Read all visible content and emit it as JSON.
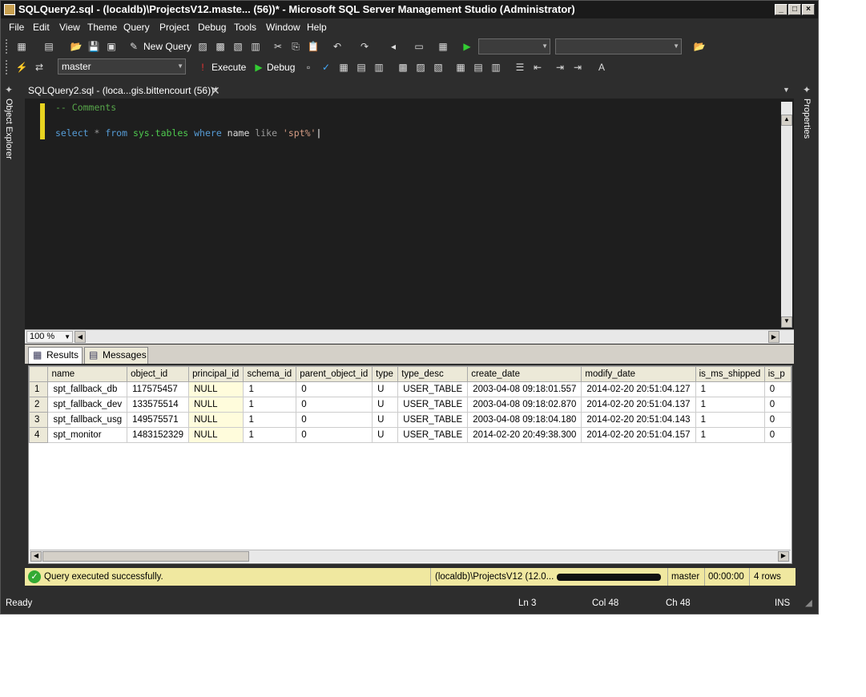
{
  "title": "SQLQuery2.sql - (localdb)\\ProjectsV12.maste... (56))* - Microsoft SQL Server Management Studio (Administrator)",
  "menu": [
    "File",
    "Edit",
    "View",
    "Theme",
    "Query",
    "Project",
    "Debug",
    "Tools",
    "Window",
    "Help"
  ],
  "toolbar": {
    "new_query_label": "New Query"
  },
  "toolbar2": {
    "database": "master",
    "execute_label": "Execute",
    "debug_label": "Debug"
  },
  "left_rail": {
    "label": "Object Explorer"
  },
  "right_rail": {
    "label": "Properties"
  },
  "doc_tab": {
    "label": "SQLQuery2.sql - (loca...gis.bittencourt (56))*"
  },
  "editor": {
    "comment": "-- Comments",
    "kw_select": "select",
    "star": " * ",
    "kw_from": "from",
    "obj": " sys.tables ",
    "kw_where": "where",
    "col": " name ",
    "kw_like": "like",
    "str": " 'spt%'"
  },
  "zoom": {
    "level": "100 %"
  },
  "results_tabs": {
    "results": "Results",
    "messages": "Messages"
  },
  "grid": {
    "columns": [
      "name",
      "object_id",
      "principal_id",
      "schema_id",
      "parent_object_id",
      "type",
      "type_desc",
      "create_date",
      "modify_date",
      "is_ms_shipped",
      "is_p"
    ],
    "rows": [
      [
        "1",
        "spt_fallback_db",
        "117575457",
        "NULL",
        "1",
        "0",
        "U",
        "USER_TABLE",
        "2003-04-08 09:18:01.557",
        "2014-02-20 20:51:04.127",
        "1",
        "0"
      ],
      [
        "2",
        "spt_fallback_dev",
        "133575514",
        "NULL",
        "1",
        "0",
        "U",
        "USER_TABLE",
        "2003-04-08 09:18:02.870",
        "2014-02-20 20:51:04.137",
        "1",
        "0"
      ],
      [
        "3",
        "spt_fallback_usg",
        "149575571",
        "NULL",
        "1",
        "0",
        "U",
        "USER_TABLE",
        "2003-04-08 09:18:04.180",
        "2014-02-20 20:51:04.143",
        "1",
        "0"
      ],
      [
        "4",
        "spt_monitor",
        "1483152329",
        "NULL",
        "1",
        "0",
        "U",
        "USER_TABLE",
        "2014-02-20 20:49:38.300",
        "2014-02-20 20:51:04.157",
        "1",
        "0"
      ]
    ]
  },
  "query_status": {
    "message": "Query executed successfully.",
    "server": "(localdb)\\ProjectsV12 (12.0...",
    "database": "master",
    "elapsed": "00:00:00",
    "rows": "4 rows"
  },
  "status_bar": {
    "state": "Ready",
    "line": "Ln 3",
    "col": "Col 48",
    "ch": "Ch 48",
    "mode": "INS"
  },
  "colors": {
    "keyword": "#569cd6",
    "comment": "#57a64a",
    "string": "#d69d85",
    "object": "#4ec94e",
    "accent_status": "#f0e8a0"
  }
}
